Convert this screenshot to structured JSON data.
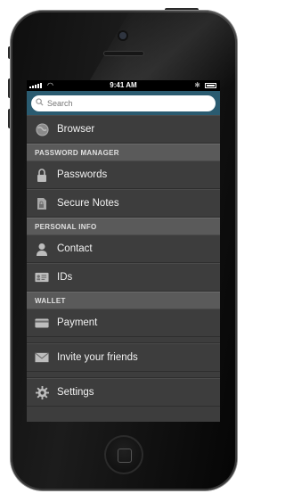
{
  "statusbar": {
    "time": "9:41 AM"
  },
  "search": {
    "placeholder": "Search"
  },
  "menu": {
    "browser": "Browser",
    "section_password_manager": "PASSWORD MANAGER",
    "passwords": "Passwords",
    "secure_notes": "Secure Notes",
    "section_personal_info": "PERSONAL INFO",
    "contact": "Contact",
    "ids": "IDs",
    "section_wallet": "WALLET",
    "payment": "Payment",
    "invite": "Invite your friends",
    "settings": "Settings"
  },
  "colors": {
    "accent": "#2a5b70",
    "list_bg": "#3d3d3d",
    "section_bg": "#5a5a5a"
  }
}
